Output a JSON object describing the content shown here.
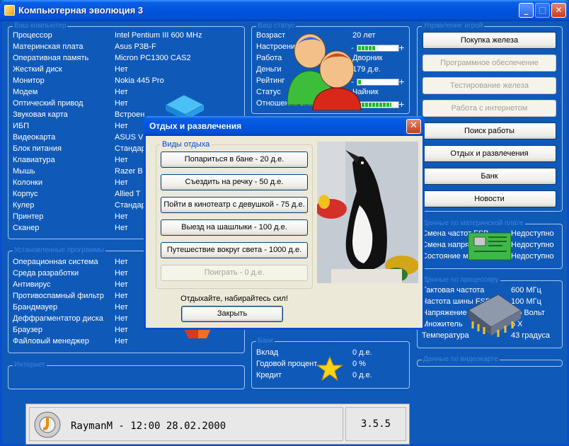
{
  "window": {
    "title": "Компьютерная эволюция 3",
    "btn_min": "_",
    "btn_max": "□",
    "btn_close": "✕"
  },
  "computer": {
    "legend": "Ваш компьютер",
    "rows": [
      {
        "k": "Процессор",
        "v": "Intel Pentium III 600 MHz"
      },
      {
        "k": "Материнская плата",
        "v": "Asus P3B-F"
      },
      {
        "k": "Оперативная память",
        "v": "Micron PC1300 CAS2"
      },
      {
        "k": "Жесткий диск",
        "v": "Нет"
      },
      {
        "k": "Монитор",
        "v": "Nokia 445 Pro"
      },
      {
        "k": "Модем",
        "v": "Нет"
      },
      {
        "k": "Оптический привод",
        "v": "Нет"
      },
      {
        "k": "Звуковая карта",
        "v": "Встроен"
      },
      {
        "k": "ИБП",
        "v": "Нет"
      },
      {
        "k": "Видеокарта",
        "v": "ASUS V"
      },
      {
        "k": "Блок питания",
        "v": "Стандар"
      },
      {
        "k": "Клавиатура",
        "v": "Нет"
      },
      {
        "k": "Мышь",
        "v": "Razer B"
      },
      {
        "k": "Колонки",
        "v": "Нет"
      },
      {
        "k": "Корпус",
        "v": "Allied T"
      },
      {
        "k": "Кулер",
        "v": "Стандар"
      },
      {
        "k": "Принтер",
        "v": "Нет"
      },
      {
        "k": "Сканер",
        "v": "Нет"
      }
    ]
  },
  "programs": {
    "legend": "Установленные программы",
    "rows": [
      {
        "k": "Операционная система",
        "v": "Нет"
      },
      {
        "k": "Среда разработки",
        "v": "Нет"
      },
      {
        "k": "Антивирус",
        "v": "Нет"
      },
      {
        "k": "Противоспамный фильтр",
        "v": "Нет"
      },
      {
        "k": "Брандмауер",
        "v": "Нет"
      },
      {
        "k": "Деффрагментатор диска",
        "v": "Нет"
      },
      {
        "k": "Браузер",
        "v": "Нет"
      },
      {
        "k": "Файловый менеджер",
        "v": "Нет"
      }
    ]
  },
  "internet": {
    "legend": "Интернет"
  },
  "status": {
    "legend": "Ваш статус",
    "age_k": "Возраст",
    "age_v": "20 лет",
    "mood_k": "Настроение",
    "mood_level": 0.45,
    "work_k": "Работа",
    "work_v": "Дворник",
    "money_k": "Деньги",
    "money_v": "179 д.е.",
    "rating_k": "Рейтинг",
    "rating_level": 0.1,
    "stat_k": "Статус",
    "stat_v": "Чайник",
    "auth_k": "Отношение властей",
    "auth_level": 0.85,
    "minus": "-",
    "plus": "+"
  },
  "bank": {
    "legend": "Банк",
    "deposit_k": "Вклад",
    "deposit_v": "0 д.е.",
    "rate_k": "Годовой процент",
    "rate_v": "0 %",
    "credit_k": "Кредит",
    "credit_v": "0 д.е."
  },
  "manage": {
    "legend": "Управление игрой",
    "buttons": [
      {
        "label": "Покупка железа",
        "enabled": true
      },
      {
        "label": "Программное обеспечение",
        "enabled": false
      },
      {
        "label": "Тестирование железа",
        "enabled": false
      },
      {
        "label": "Работа с интернетом",
        "enabled": false
      },
      {
        "label": "Поиск работы",
        "enabled": true
      },
      {
        "label": "Отдых и развлечения",
        "enabled": true
      },
      {
        "label": "Банк",
        "enabled": true
      },
      {
        "label": "Новости",
        "enabled": true
      }
    ]
  },
  "mobo": {
    "legend": "Данные по материнской плате",
    "rows": [
      {
        "k": "Смена частот FSB",
        "v": "Недоступно"
      },
      {
        "k": "Смена напряжения",
        "v": "Недоступно"
      },
      {
        "k": "Состояние мониторинга",
        "v": "Недоступно"
      }
    ]
  },
  "cpu": {
    "legend": "Данные по процессору",
    "rows": [
      {
        "k": "Тактовая частота",
        "v": "600 МГц"
      },
      {
        "k": "Частота шины FSB",
        "v": "100 МГц"
      },
      {
        "k": "Напряжение",
        "v": "1.5 Вольт"
      },
      {
        "k": "Множитель",
        "v": "6 X"
      },
      {
        "k": "Температура",
        "v": "43 градуса"
      }
    ]
  },
  "video": {
    "legend": "Данные по видеокарте"
  },
  "dialog": {
    "title": "Отдых и развлечения",
    "close_glyph": "✕",
    "group_legend": "Виды отдыха",
    "options": [
      {
        "label": "Попариться в бане - 20 д.е.",
        "enabled": true
      },
      {
        "label": "Съездить на речку - 50 д.е.",
        "enabled": true
      },
      {
        "label": "Пойти в кинотеатр с девушкой - 75 д.е.",
        "enabled": true
      },
      {
        "label": "Выезд на шашлыки - 100 д.е.",
        "enabled": true
      },
      {
        "label": "Путешествие вокруг света - 1000 д.е.",
        "enabled": true
      },
      {
        "label": "Поиграть - 0 д.е.",
        "enabled": false
      }
    ],
    "message": "Отдыхайте, набирайтесь сил!",
    "close_label": "Закрыть"
  },
  "statusbar": {
    "user_line": "RaymanM - 12:00 28.02.2000",
    "version": "3.5.5"
  },
  "colors": {
    "background": "#0f59b8",
    "legend": "#3b84e0",
    "bar_fill": "#1dbb2a",
    "titlebar": "#0155dd"
  }
}
